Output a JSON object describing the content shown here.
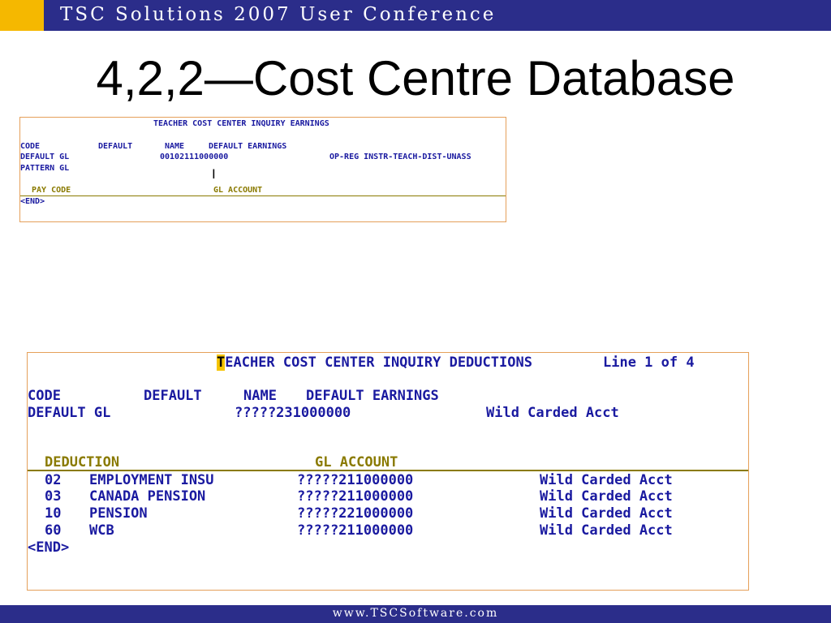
{
  "header": {
    "title": "TSC Solutions 2007 User Conference"
  },
  "slide": {
    "title": "4,2,2—Cost Centre Database"
  },
  "footer": {
    "url": "www.TSCSoftware.com"
  },
  "screen_earnings": {
    "title": "TEACHER COST CENTER INQUIRY EARNINGS",
    "code_label": "CODE",
    "default_label": "DEFAULT",
    "name_label": "NAME",
    "default_earnings_label": "DEFAULT EARNINGS",
    "default_gl_label": "DEFAULT GL",
    "default_gl_value": "00102111000000",
    "default_gl_desc": "OP-REG INSTR-TEACH-DIST-UNASS",
    "pattern_gl_label": "PATTERN GL",
    "col_pay_code": "PAY CODE",
    "col_gl_account": "GL ACCOUNT",
    "end_marker": "<END>"
  },
  "screen_deductions": {
    "title_first": "T",
    "title_rest": "EACHER COST CENTER INQUIRY DEDUCTIONS",
    "line_info": "Line 1 of 4",
    "code_label": "CODE",
    "default_label": "DEFAULT",
    "name_label": "NAME",
    "default_earnings_label": "DEFAULT EARNINGS",
    "default_gl_label": "DEFAULT GL",
    "default_gl_value": "?????231000000",
    "default_gl_desc": "Wild Carded Acct",
    "col_deduction": "DEDUCTION",
    "col_gl_account": "GL ACCOUNT",
    "rows": [
      {
        "code": "02",
        "name": "EMPLOYMENT INSU",
        "gl": "?????211000000",
        "desc": "Wild Carded Acct"
      },
      {
        "code": "03",
        "name": "CANADA PENSION",
        "gl": "?????211000000",
        "desc": "Wild Carded Acct"
      },
      {
        "code": "10",
        "name": "PENSION",
        "gl": "?????221000000",
        "desc": "Wild Carded Acct"
      },
      {
        "code": "60",
        "name": "WCB",
        "gl": "?????211000000",
        "desc": "Wild Carded Acct"
      }
    ],
    "end_marker": "<END>"
  },
  "colors": {
    "banner": "#2b2d8a",
    "accent": "#f5b800",
    "terminal_text": "#1a1aa0",
    "terminal_header": "#8a7a00",
    "terminal_border": "#e5a05a"
  }
}
